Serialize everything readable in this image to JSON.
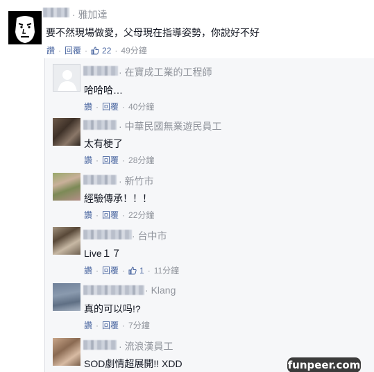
{
  "top_comment": {
    "location": "雅加達",
    "text": "要不然現場做愛，父母現在指導姿勢，你說好不好",
    "actions": {
      "like": "讚",
      "reply": "回覆",
      "likes": "22",
      "time": "49分鐘"
    }
  },
  "replies": [
    {
      "location": "在寶成工業的工程師",
      "text": "哈哈哈…",
      "actions": {
        "like": "讚",
        "reply": "回覆",
        "time": "40分鐘"
      }
    },
    {
      "location": "中華民國無業遊民員工",
      "text": "太有梗了",
      "actions": {
        "like": "讚",
        "reply": "回覆",
        "time": "28分鐘"
      }
    },
    {
      "location": "新竹市",
      "text": "經驗傳承！！！",
      "actions": {
        "like": "讚",
        "reply": "回覆",
        "time": "22分鐘"
      }
    },
    {
      "location": "台中市",
      "text": "Live１７",
      "actions": {
        "like": "讚",
        "reply": "回覆",
        "likes": "1",
        "time": "11分鐘"
      }
    },
    {
      "location": "Klang",
      "text": "真的可以吗!?",
      "actions": {
        "like": "讚",
        "reply": "回覆",
        "time": "7分鐘"
      }
    },
    {
      "location": "流浪漢員工",
      "text": "SOD劇情超展開!! XDD"
    }
  ],
  "watermark": "funpeer.com",
  "colors": {
    "link": "#4b67a1",
    "meta": "#90949c",
    "text": "#141823",
    "reply_bg": "#f6f7f9"
  }
}
